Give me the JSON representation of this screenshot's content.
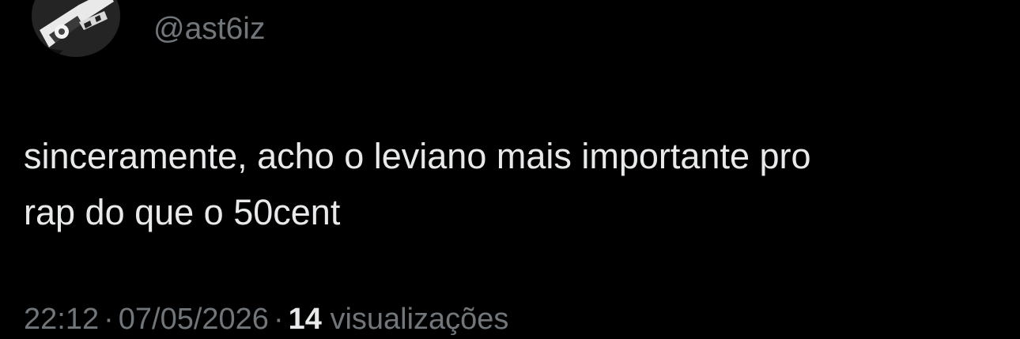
{
  "author": {
    "handle": "@ast6iz",
    "avatar_icon": "profile-avatar-image"
  },
  "tweet": {
    "text": "sinceramente, acho o leviano mais importante pro\nrap do que o 50cent"
  },
  "meta": {
    "time": "22:12",
    "separator": "·",
    "date": "07/05/2026",
    "views_count": "14",
    "views_label": "visualizações"
  },
  "colors": {
    "background": "#000000",
    "primary_text": "#e7e9ea",
    "secondary_text": "#71767b"
  }
}
